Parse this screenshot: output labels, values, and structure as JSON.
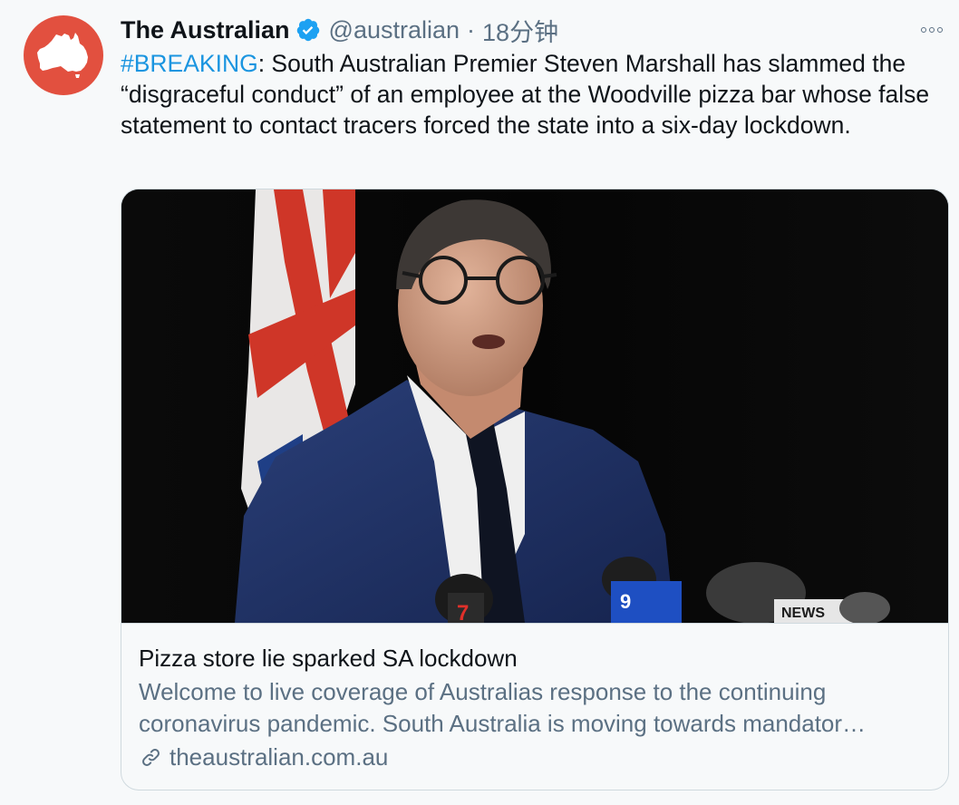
{
  "tweet": {
    "display_name": "The Australian",
    "handle": "@australian",
    "separator": "·",
    "timestamp": "18分钟",
    "hashtag": "#BREAKING",
    "text": ": South Australian Premier Steven Marshall has slammed the “disgraceful conduct” of an employee at the Woodville pizza bar whose false statement to contact tracers forced the state into a six-day lockdown."
  },
  "card": {
    "title": "Pizza store lie sparked SA lockdown",
    "description": "Welcome to live coverage of Australias response to the continuing coronavirus pandemic. South Australia is moving towards mandator…",
    "domain": "theaustralian.com.au"
  },
  "colors": {
    "accent": "#1b95e0",
    "avatar_bg": "#e2503f",
    "secondary_text": "#5b7083"
  },
  "icons": {
    "verified": "verified-badge-icon",
    "more": "more-options-icon",
    "link": "link-icon",
    "avatar": "australia-map-logo"
  }
}
